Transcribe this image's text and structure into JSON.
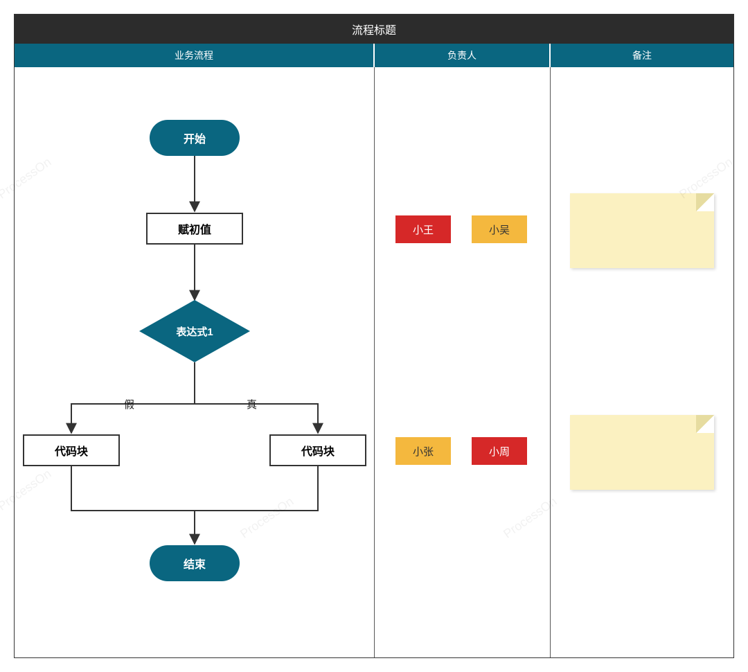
{
  "title": "流程标题",
  "columns": {
    "c1": "业务流程",
    "c2": "负责人",
    "c3": "备注"
  },
  "flow": {
    "start": "开始",
    "init": "赋初值",
    "decision": "表达式1",
    "branch_false": "假",
    "branch_true": "真",
    "code_left": "代码块",
    "code_right": "代码块",
    "end": "结束"
  },
  "owners": {
    "row1_a": "小王",
    "row1_b": "小吴",
    "row2_a": "小张",
    "row2_b": "小周"
  },
  "colors": {
    "teal": "#0a6680",
    "dark": "#2c2c2c",
    "red": "#d62828",
    "amber": "#f4b83e",
    "note": "#fbf1c1"
  },
  "watermark": "ProcessOn"
}
